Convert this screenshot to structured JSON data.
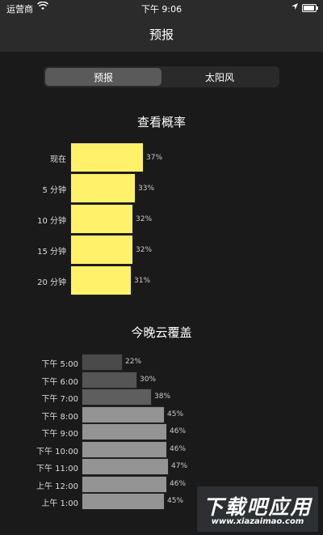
{
  "status_bar": {
    "carrier": "运营商",
    "wifi_icon": "wifi-icon",
    "time": "下午 9:06"
  },
  "nav": {
    "title": "预报"
  },
  "tabs": [
    {
      "label": "预报",
      "selected": true
    },
    {
      "label": "太阳风",
      "selected": false
    }
  ],
  "probability": {
    "title": "查看概率",
    "color": "#fff16a",
    "items": [
      {
        "label": "现在",
        "value": 37,
        "value_text": "37%"
      },
      {
        "label": "5 分钟",
        "value": 33,
        "value_text": "33%"
      },
      {
        "label": "10 分钟",
        "value": 32,
        "value_text": "32%"
      },
      {
        "label": "15 分钟",
        "value": 32,
        "value_text": "32%"
      },
      {
        "label": "20 分钟",
        "value": 31,
        "value_text": "31%"
      }
    ]
  },
  "cloud_cover": {
    "title": "今晚云覆盖",
    "items": [
      {
        "label": "下午 5:00",
        "value": 22,
        "value_text": "22%",
        "color": "#4a4a4a"
      },
      {
        "label": "下午 6:00",
        "value": 30,
        "value_text": "30%",
        "color": "#555555"
      },
      {
        "label": "下午 7:00",
        "value": 38,
        "value_text": "38%",
        "color": "#5e5e5e"
      },
      {
        "label": "下午 8:00",
        "value": 45,
        "value_text": "45%",
        "color": "#949494"
      },
      {
        "label": "下午 9:00",
        "value": 46,
        "value_text": "46%",
        "color": "#949494"
      },
      {
        "label": "下午 10:00",
        "value": 46,
        "value_text": "46%",
        "color": "#949494"
      },
      {
        "label": "下午 11:00",
        "value": 47,
        "value_text": "47%",
        "color": "#949494"
      },
      {
        "label": "上午 12:00",
        "value": 46,
        "value_text": "46%",
        "color": "#949494"
      },
      {
        "label": "上午 1:00",
        "value": 45,
        "value_text": "45%",
        "color": "#949494"
      }
    ]
  },
  "watermark": {
    "main": "下载吧应用",
    "url": "www.xiazaimao.com"
  }
}
